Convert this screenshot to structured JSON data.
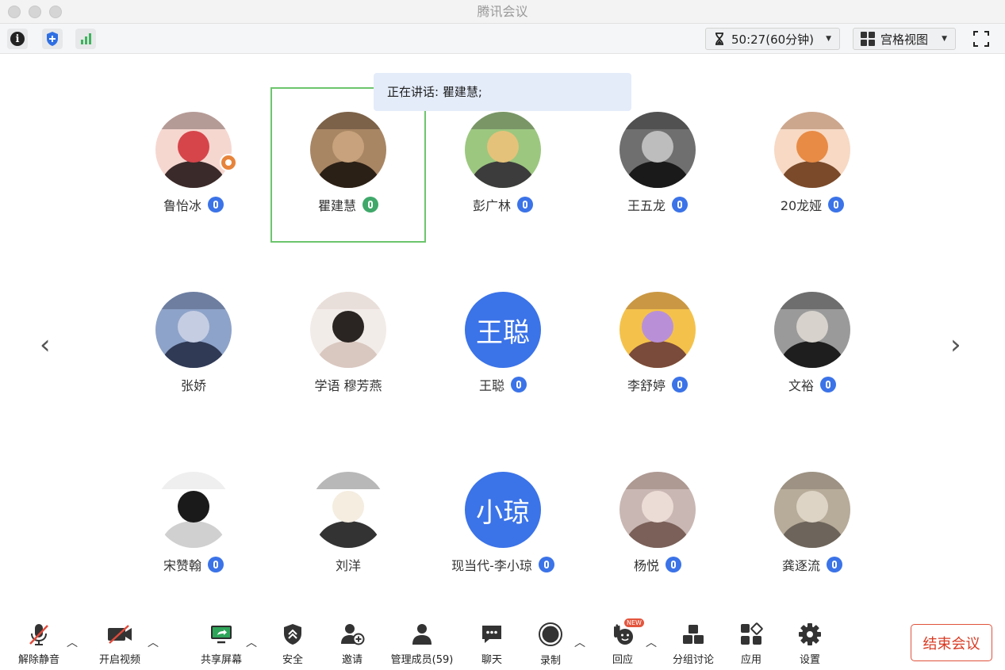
{
  "app": {
    "title": "腾讯会议"
  },
  "topbar": {
    "timer": "50:27(60分钟)",
    "view_mode": "宫格视图"
  },
  "speaking_banner": "正在讲话: 瞿建慧;",
  "participants": [
    {
      "name": "鲁怡冰",
      "avatar": "photo",
      "mic": "muted",
      "host": true
    },
    {
      "name": "瞿建慧",
      "avatar": "photo",
      "mic": "speaking",
      "active": true
    },
    {
      "name": "彭广林",
      "avatar": "photo",
      "mic": "muted"
    },
    {
      "name": "王五龙",
      "avatar": "photo",
      "mic": "muted"
    },
    {
      "name": "20龙娅",
      "avatar": "photo",
      "mic": "muted"
    },
    {
      "name": "张娇",
      "avatar": "photo",
      "mic": "none"
    },
    {
      "name": "学语 穆芳燕",
      "avatar": "photo",
      "mic": "none"
    },
    {
      "name": "王聪",
      "avatar_text": "王聪",
      "mic": "muted"
    },
    {
      "name": "李舒婷",
      "avatar": "photo",
      "mic": "muted"
    },
    {
      "name": "文裕",
      "avatar": "photo",
      "mic": "muted"
    },
    {
      "name": "宋赞翰",
      "avatar": "photo",
      "mic": "muted"
    },
    {
      "name": "刘洋",
      "avatar": "photo",
      "mic": "none"
    },
    {
      "name": "现当代-李小琼",
      "avatar_text": "小琼",
      "mic": "muted"
    },
    {
      "name": "杨悦",
      "avatar": "photo",
      "mic": "muted"
    },
    {
      "name": "龚逐流",
      "avatar": "photo",
      "mic": "muted"
    }
  ],
  "toolbar": {
    "unmute": "解除静音",
    "start_video": "开启视频",
    "share_screen": "共享屏幕",
    "security": "安全",
    "invite": "邀请",
    "manage_members": "管理成员(59)",
    "chat": "聊天",
    "record": "录制",
    "reactions": "回应",
    "reactions_badge": "NEW",
    "breakout": "分组讨论",
    "apps": "应用",
    "settings": "设置",
    "end_meeting": "结束会议"
  },
  "colors": {
    "accent": "#3b73e8",
    "speaking_border": "#6cc56c",
    "end_button": "#d83b24"
  }
}
